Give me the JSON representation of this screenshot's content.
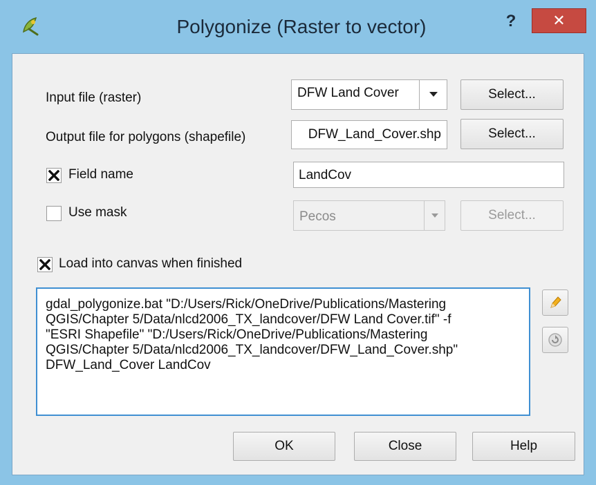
{
  "window": {
    "title": "Polygonize (Raster to vector)",
    "help_label": "?",
    "close_label": "✕",
    "accent": "#8bc4e6",
    "close_color": "#c64a41"
  },
  "input_file": {
    "label": "Input file (raster)",
    "value": "DFW Land Cover",
    "select_label": "Select..."
  },
  "output_file": {
    "label": "Output file for polygons (shapefile)",
    "value": "DFW_Land_Cover.shp",
    "select_label": "Select..."
  },
  "field_name": {
    "label": "Field name",
    "checked": true,
    "value": "LandCov"
  },
  "use_mask": {
    "label": "Use mask",
    "checked": false,
    "value": "Pecos",
    "select_label": "Select..."
  },
  "load_canvas": {
    "label": "Load into canvas when finished",
    "checked": true
  },
  "command": {
    "lines": [
      "gdal_polygonize.bat \"D:/Users/Rick/OneDrive/Publications/Mastering",
      "QGIS/Chapter 5/Data/nlcd2006_TX_landcover/DFW Land Cover.tif\" -f",
      "\"ESRI Shapefile\" \"D:/Users/Rick/OneDrive/Publications/Mastering",
      "QGIS/Chapter 5/Data/nlcd2006_TX_landcover/DFW_Land_Cover.shp\"",
      "DFW_Land_Cover LandCov"
    ]
  },
  "side_buttons": {
    "edit_icon": "pencil-icon",
    "reset_icon": "reset-icon"
  },
  "buttons": {
    "ok": "OK",
    "close": "Close",
    "help": "Help"
  }
}
